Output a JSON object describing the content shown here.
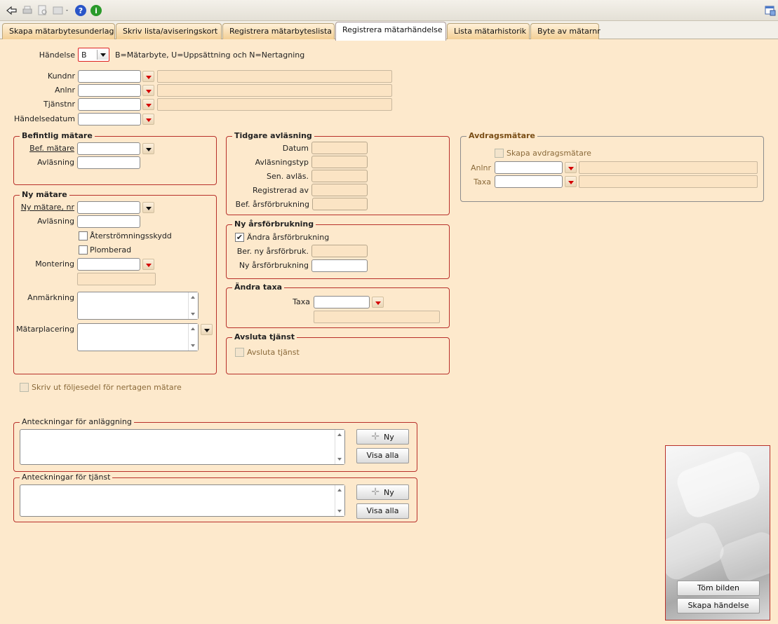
{
  "tabs": [
    {
      "label": "Skapa mätarbytesunderlag"
    },
    {
      "label": "Skriv lista/aviseringskort"
    },
    {
      "label": "Registrera mätarbyteslista"
    },
    {
      "label": "Registrera mätarhändelse"
    },
    {
      "label": "Lista mätarhistorik"
    },
    {
      "label": "Byte av mätarnr"
    }
  ],
  "event": {
    "label": "Händelse",
    "value": "B",
    "hint": "B=Mätarbyte, U=Uppsättning och N=Nertagning"
  },
  "top_fields": {
    "kundnr": "Kundnr",
    "anlnr": "Anlnr",
    "tjanstnr": "Tjänstnr",
    "handelsedatum": "Händelsedatum"
  },
  "befintlig": {
    "title": "Befintlig mätare",
    "bef_matare": "Bef. mätare",
    "avlasning": "Avläsning"
  },
  "ny_matare": {
    "title": "Ny mätare",
    "ny_matare_nr": "Ny mätare, nr",
    "avlasning": "Avläsning",
    "aterstromning": "Återströmningsskydd",
    "plomberad": "Plomberad",
    "montering": "Montering",
    "anmarkning": "Anmärkning",
    "matarplacering": "Mätarplacering"
  },
  "tidigare": {
    "title": "Tidgare avläsning",
    "datum": "Datum",
    "avlasningstyp": "Avläsningstyp",
    "sen_avlas": "Sen. avläs.",
    "registrerad_av": "Registrerad av",
    "bef_arsforbrukning": "Bef. årsförbrukning"
  },
  "ny_ars": {
    "title": "Ny årsförbrukning",
    "andra": "Ändra årsförbrukning",
    "ber_ny": "Ber.  ny årsförbruk.",
    "ny_ars": "Ny årsförbrukning"
  },
  "andra_taxa": {
    "title": "Ändra taxa",
    "taxa": "Taxa"
  },
  "avsluta": {
    "title": "Avsluta tjänst",
    "checkbox": "Avsluta tjänst"
  },
  "avdrag": {
    "title": "Avdragsmätare",
    "skapa": "Skapa avdragsmätare",
    "anlnr": "Anlnr",
    "taxa": "Taxa"
  },
  "skriv_ut": "Skriv ut följesedel för nertagen mätare",
  "notes_anl": {
    "title": "Anteckningar för anläggning",
    "new": "Ny",
    "show_all": "Visa alla"
  },
  "notes_tj": {
    "title": "Anteckningar för tjänst",
    "new": "Ny",
    "show_all": "Visa alla"
  },
  "buttons": {
    "clear": "Töm bilden",
    "create": "Skapa händelse"
  },
  "colors": {
    "background": "#fde9cc",
    "group_border": "#b8302a",
    "accent_red": "#d40000"
  }
}
